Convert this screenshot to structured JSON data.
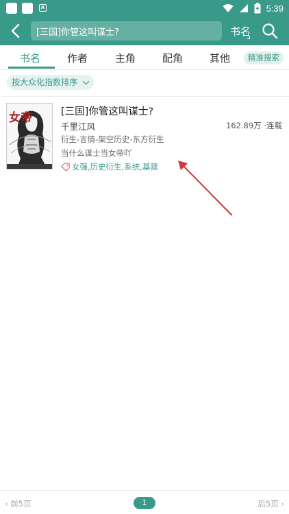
{
  "status_bar": {
    "time": "5:39",
    "app_icon_label": "A",
    "icons": [
      "wifi-icon",
      "signal-icon",
      "battery-icon"
    ]
  },
  "toolbar": {
    "search_value": "[三国]你管这叫谋士?",
    "search_type": "书名",
    "icons": [
      "back-arrow-icon",
      "search-icon"
    ]
  },
  "tabs": [
    {
      "label": "书名",
      "active": true
    },
    {
      "label": "作者",
      "active": false
    },
    {
      "label": "主角",
      "active": false
    },
    {
      "label": "配角",
      "active": false
    },
    {
      "label": "其他",
      "active": false
    }
  ],
  "precise_search_label": "精准搜索",
  "sort": {
    "label": "按大众化指数排序"
  },
  "results": [
    {
      "title": "[三国]你管这叫谋士?",
      "author": "千里江风",
      "word_count": "162.89万",
      "status": "连载",
      "meta": "162.89万 ·连载",
      "category": "衍生-言情-架空历史-东方衍生",
      "intro": "当什么谋士当女帝吖",
      "tags": "女强,历史衍生,系统,基建",
      "cover_text": "女帝"
    }
  ],
  "pager": {
    "prev_label": "前5页",
    "next_label": "后5页",
    "current_page": "1"
  },
  "colors": {
    "primary": "#3a9a8a",
    "annotation_arrow": "#d9343a"
  }
}
